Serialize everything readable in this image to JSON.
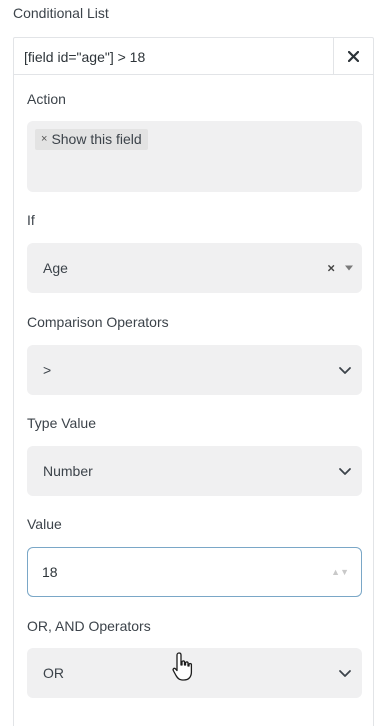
{
  "section": {
    "title": "Conditional List"
  },
  "rule": {
    "title": "[field id=\"age\"] > 18",
    "remove_icon": "close-icon"
  },
  "action": {
    "label": "Action",
    "tags": [
      {
        "label": "Show this field",
        "remove_glyph": "×"
      }
    ]
  },
  "if": {
    "label": "If",
    "value": "Age",
    "clear_glyph": "×"
  },
  "comparison": {
    "label": "Comparison Operators",
    "value": ">"
  },
  "type_value": {
    "label": "Type Value",
    "value": "Number"
  },
  "value": {
    "label": "Value",
    "input": "18"
  },
  "logic": {
    "label": "OR, AND Operators",
    "value": "OR"
  },
  "colors": {
    "field_bg": "#f0f0f1",
    "border": "#e2e4e7",
    "focus_border": "#7aa7c7",
    "text": "#3c434a"
  }
}
